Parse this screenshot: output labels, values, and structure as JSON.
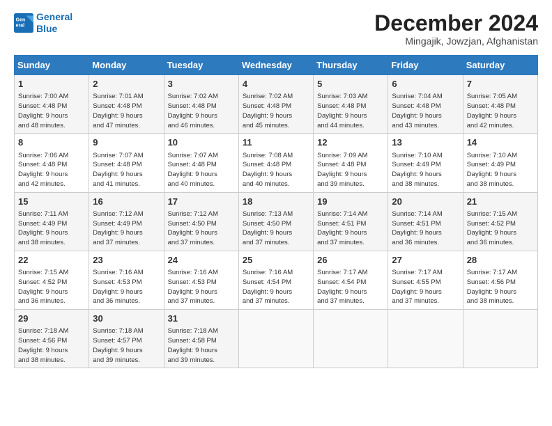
{
  "header": {
    "logo_line1": "General",
    "logo_line2": "Blue",
    "month": "December 2024",
    "location": "Mingajik, Jowzjan, Afghanistan"
  },
  "days_of_week": [
    "Sunday",
    "Monday",
    "Tuesday",
    "Wednesday",
    "Thursday",
    "Friday",
    "Saturday"
  ],
  "weeks": [
    [
      {
        "day": "1",
        "info": "Sunrise: 7:00 AM\nSunset: 4:48 PM\nDaylight: 9 hours\nand 48 minutes."
      },
      {
        "day": "2",
        "info": "Sunrise: 7:01 AM\nSunset: 4:48 PM\nDaylight: 9 hours\nand 47 minutes."
      },
      {
        "day": "3",
        "info": "Sunrise: 7:02 AM\nSunset: 4:48 PM\nDaylight: 9 hours\nand 46 minutes."
      },
      {
        "day": "4",
        "info": "Sunrise: 7:02 AM\nSunset: 4:48 PM\nDaylight: 9 hours\nand 45 minutes."
      },
      {
        "day": "5",
        "info": "Sunrise: 7:03 AM\nSunset: 4:48 PM\nDaylight: 9 hours\nand 44 minutes."
      },
      {
        "day": "6",
        "info": "Sunrise: 7:04 AM\nSunset: 4:48 PM\nDaylight: 9 hours\nand 43 minutes."
      },
      {
        "day": "7",
        "info": "Sunrise: 7:05 AM\nSunset: 4:48 PM\nDaylight: 9 hours\nand 42 minutes."
      }
    ],
    [
      {
        "day": "8",
        "info": "Sunrise: 7:06 AM\nSunset: 4:48 PM\nDaylight: 9 hours\nand 42 minutes."
      },
      {
        "day": "9",
        "info": "Sunrise: 7:07 AM\nSunset: 4:48 PM\nDaylight: 9 hours\nand 41 minutes."
      },
      {
        "day": "10",
        "info": "Sunrise: 7:07 AM\nSunset: 4:48 PM\nDaylight: 9 hours\nand 40 minutes."
      },
      {
        "day": "11",
        "info": "Sunrise: 7:08 AM\nSunset: 4:48 PM\nDaylight: 9 hours\nand 40 minutes."
      },
      {
        "day": "12",
        "info": "Sunrise: 7:09 AM\nSunset: 4:48 PM\nDaylight: 9 hours\nand 39 minutes."
      },
      {
        "day": "13",
        "info": "Sunrise: 7:10 AM\nSunset: 4:49 PM\nDaylight: 9 hours\nand 38 minutes."
      },
      {
        "day": "14",
        "info": "Sunrise: 7:10 AM\nSunset: 4:49 PM\nDaylight: 9 hours\nand 38 minutes."
      }
    ],
    [
      {
        "day": "15",
        "info": "Sunrise: 7:11 AM\nSunset: 4:49 PM\nDaylight: 9 hours\nand 38 minutes."
      },
      {
        "day": "16",
        "info": "Sunrise: 7:12 AM\nSunset: 4:49 PM\nDaylight: 9 hours\nand 37 minutes."
      },
      {
        "day": "17",
        "info": "Sunrise: 7:12 AM\nSunset: 4:50 PM\nDaylight: 9 hours\nand 37 minutes."
      },
      {
        "day": "18",
        "info": "Sunrise: 7:13 AM\nSunset: 4:50 PM\nDaylight: 9 hours\nand 37 minutes."
      },
      {
        "day": "19",
        "info": "Sunrise: 7:14 AM\nSunset: 4:51 PM\nDaylight: 9 hours\nand 37 minutes."
      },
      {
        "day": "20",
        "info": "Sunrise: 7:14 AM\nSunset: 4:51 PM\nDaylight: 9 hours\nand 36 minutes."
      },
      {
        "day": "21",
        "info": "Sunrise: 7:15 AM\nSunset: 4:52 PM\nDaylight: 9 hours\nand 36 minutes."
      }
    ],
    [
      {
        "day": "22",
        "info": "Sunrise: 7:15 AM\nSunset: 4:52 PM\nDaylight: 9 hours\nand 36 minutes."
      },
      {
        "day": "23",
        "info": "Sunrise: 7:16 AM\nSunset: 4:53 PM\nDaylight: 9 hours\nand 36 minutes."
      },
      {
        "day": "24",
        "info": "Sunrise: 7:16 AM\nSunset: 4:53 PM\nDaylight: 9 hours\nand 37 minutes."
      },
      {
        "day": "25",
        "info": "Sunrise: 7:16 AM\nSunset: 4:54 PM\nDaylight: 9 hours\nand 37 minutes."
      },
      {
        "day": "26",
        "info": "Sunrise: 7:17 AM\nSunset: 4:54 PM\nDaylight: 9 hours\nand 37 minutes."
      },
      {
        "day": "27",
        "info": "Sunrise: 7:17 AM\nSunset: 4:55 PM\nDaylight: 9 hours\nand 37 minutes."
      },
      {
        "day": "28",
        "info": "Sunrise: 7:17 AM\nSunset: 4:56 PM\nDaylight: 9 hours\nand 38 minutes."
      }
    ],
    [
      {
        "day": "29",
        "info": "Sunrise: 7:18 AM\nSunset: 4:56 PM\nDaylight: 9 hours\nand 38 minutes."
      },
      {
        "day": "30",
        "info": "Sunrise: 7:18 AM\nSunset: 4:57 PM\nDaylight: 9 hours\nand 39 minutes."
      },
      {
        "day": "31",
        "info": "Sunrise: 7:18 AM\nSunset: 4:58 PM\nDaylight: 9 hours\nand 39 minutes."
      },
      null,
      null,
      null,
      null
    ]
  ]
}
